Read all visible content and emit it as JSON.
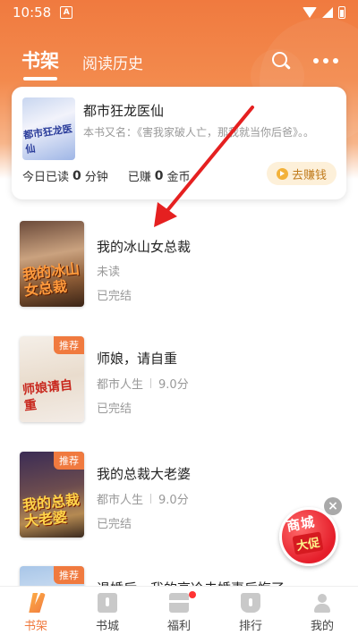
{
  "status_bar": {
    "time": "10:58",
    "indicator": "A"
  },
  "header": {
    "tabs": [
      {
        "label": "书架",
        "active": true
      },
      {
        "label": "阅读历史",
        "active": false
      }
    ],
    "icons": [
      "search-icon",
      "more-icon"
    ],
    "accent_color": "#f07a3f"
  },
  "recent_book": {
    "cover_text": "都市狂龙医仙",
    "title": "都市狂龙医仙",
    "subtitle": "本书又名：《害我家破人亡，那我就当你后爸》。。",
    "read_prefix": "今日已读",
    "read_value": "0",
    "read_unit": "分钟",
    "earn_prefix": "已赚",
    "earn_value": "0",
    "earn_unit": "金币",
    "earn_button": "去赚钱"
  },
  "books": [
    {
      "title": "我的冰山女总裁",
      "cover_text": "我的冰山女总裁",
      "meta": "未读",
      "rating": "",
      "status": "已完结",
      "badge": ""
    },
    {
      "title": "师娘，请自重",
      "cover_text": "师娘请自重",
      "meta": "都市人生",
      "rating": "9.0分",
      "status": "已完结",
      "badge": "推荐"
    },
    {
      "title": "我的总裁大老婆",
      "cover_text": "我的总裁大老婆",
      "meta": "都市人生",
      "rating": "9.0分",
      "status": "已完结",
      "badge": "推荐"
    },
    {
      "title": "退婚后，我的高冷未婚妻后悔了",
      "cover_text": "",
      "meta": "",
      "rating": "",
      "status": "",
      "badge": "推荐"
    }
  ],
  "promo": {
    "line1": "商城",
    "line2": "大促",
    "close": "×"
  },
  "bottom_nav": [
    {
      "label": "书架",
      "icon": "bookshelf-icon",
      "active": true
    },
    {
      "label": "书城",
      "icon": "bookstore-icon",
      "active": false
    },
    {
      "label": "福利",
      "icon": "gift-icon",
      "active": false
    },
    {
      "label": "排行",
      "icon": "ranking-icon",
      "active": false
    },
    {
      "label": "我的",
      "icon": "profile-icon",
      "active": false
    }
  ]
}
